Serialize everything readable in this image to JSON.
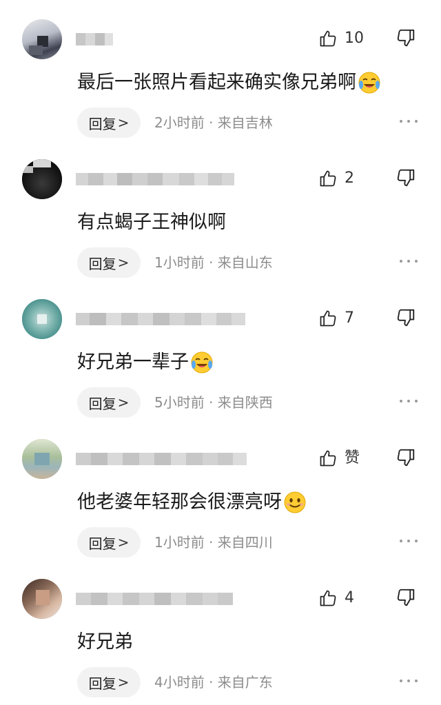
{
  "icons": {
    "like": "thumbs-up-outline-icon",
    "dislike": "thumbs-down-outline-icon",
    "more": "more-dots-icon",
    "cry_laugh": "tears-of-joy-emoji",
    "smile": "smiling-face-emoji"
  },
  "reply_label": "回复",
  "reply_chevron": ">",
  "comments": [
    {
      "text": "最后一张照片看起来确实像兄弟啊",
      "emoji": "cry_laugh",
      "likes": "10",
      "time": "2小时前",
      "location": "来自吉林",
      "meta": "2小时前 · 来自吉林"
    },
    {
      "text": "有点蝎子王神似啊",
      "emoji": "",
      "likes": "2",
      "time": "1小时前",
      "location": "来自山东",
      "meta": "1小时前 · 来自山东"
    },
    {
      "text": "好兄弟一辈子",
      "emoji": "cry_laugh",
      "likes": "7",
      "time": "5小时前",
      "location": "来自陕西",
      "meta": "5小时前 · 来自陕西"
    },
    {
      "text": "他老婆年轻那会很漂亮呀",
      "emoji": "smile",
      "likes": "赞",
      "time": "1小时前",
      "location": "来自四川",
      "meta": "1小时前 · 来自四川"
    },
    {
      "text": "好兄弟",
      "emoji": "",
      "likes": "4",
      "time": "4小时前",
      "location": "来自广东",
      "meta": "4小时前 · 来自广东"
    }
  ]
}
